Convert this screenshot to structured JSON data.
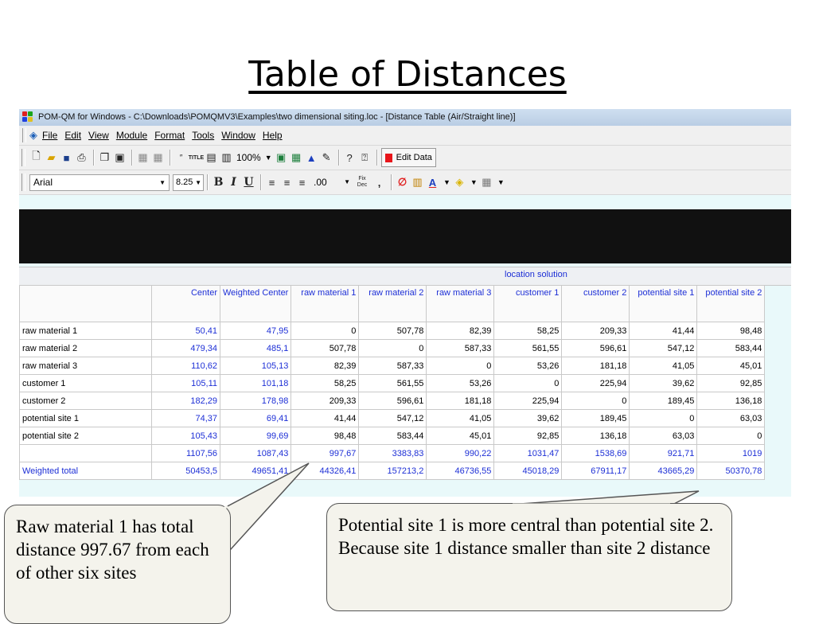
{
  "slide": {
    "title": "Table of Distances"
  },
  "window": {
    "title": "POM-QM for Windows - C:\\Downloads\\POMQMV3\\Examples\\two dimensional siting.loc - [Distance Table (Air/Straight line)]"
  },
  "menu": [
    "File",
    "Edit",
    "View",
    "Module",
    "Format",
    "Tools",
    "Window",
    "Help"
  ],
  "toolbar": {
    "zoom": "100%",
    "edit_data_label": "Edit Data",
    "title_icon_text": "TITLE"
  },
  "format_bar": {
    "font": "Arial",
    "size": "8.25",
    "bold": "B",
    "italic": "I",
    "underline": "U",
    "decimal": ".00",
    "fix_dec": "Fix Dec",
    "comma": ","
  },
  "table": {
    "group_label": "location solution",
    "columns": [
      "Center",
      "Weighted Center",
      "raw material 1",
      "raw material 2",
      "raw material 3",
      "customer 1",
      "customer 2",
      "potential site 1",
      "potential site 2"
    ],
    "rows": [
      {
        "label": "raw material 1",
        "values": [
          "50,41",
          "47,95",
          "0",
          "507,78",
          "82,39",
          "58,25",
          "209,33",
          "41,44",
          "98,48"
        ]
      },
      {
        "label": "raw material 2",
        "values": [
          "479,34",
          "485,1",
          "507,78",
          "0",
          "587,33",
          "561,55",
          "596,61",
          "547,12",
          "583,44"
        ]
      },
      {
        "label": "raw material 3",
        "values": [
          "110,62",
          "105,13",
          "82,39",
          "587,33",
          "0",
          "53,26",
          "181,18",
          "41,05",
          "45,01"
        ]
      },
      {
        "label": "customer 1",
        "values": [
          "105,11",
          "101,18",
          "58,25",
          "561,55",
          "53,26",
          "0",
          "225,94",
          "39,62",
          "92,85"
        ]
      },
      {
        "label": "customer 2",
        "values": [
          "182,29",
          "178,98",
          "209,33",
          "596,61",
          "181,18",
          "225,94",
          "0",
          "189,45",
          "136,18"
        ]
      },
      {
        "label": "potential site 1",
        "values": [
          "74,37",
          "69,41",
          "41,44",
          "547,12",
          "41,05",
          "39,62",
          "189,45",
          "0",
          "63,03"
        ]
      },
      {
        "label": "potential site 2",
        "values": [
          "105,43",
          "99,69",
          "98,48",
          "583,44",
          "45,01",
          "92,85",
          "136,18",
          "63,03",
          "0"
        ]
      }
    ],
    "total_row": {
      "label": "",
      "values": [
        "1107,56",
        "1087,43",
        "997,67",
        "3383,83",
        "990,22",
        "1031,47",
        "1538,69",
        "921,71",
        "1019"
      ]
    },
    "weighted_row": {
      "label": "Weighted total",
      "values": [
        "50453,5",
        "49651,41",
        "44326,41",
        "157213,2",
        "46736,55",
        "45018,29",
        "67911,17",
        "43665,29",
        "50370,78"
      ]
    }
  },
  "callouts": {
    "left": "Raw material 1 has total distance 997.67 from each of other six sites",
    "right": "Potential site 1 is more central than potential site 2. Because site 1 distance smaller than site 2 distance"
  },
  "colors": {
    "blue_text": "#1d2fd6",
    "title_bar": "#c7d8ec",
    "app_background": "#e9f9fa",
    "callout_fill": "#f4f3ec"
  }
}
